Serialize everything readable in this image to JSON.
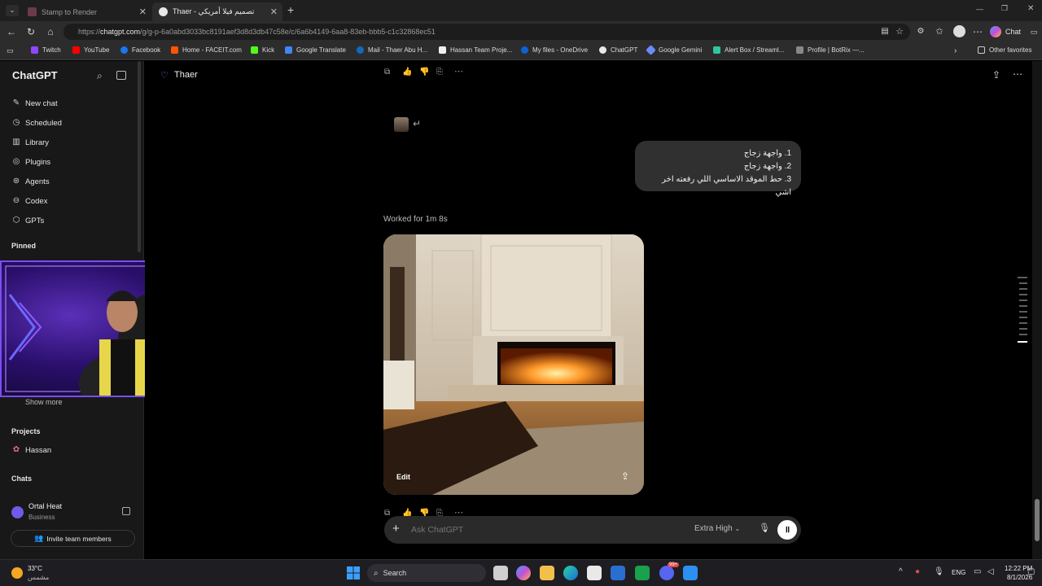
{
  "browser": {
    "tabs": [
      {
        "title": "Stamp to Render",
        "active": false
      },
      {
        "title": "Thaer - تصميم فيلا أمريكي",
        "active": true
      }
    ],
    "url_prefix": "https://",
    "url_host": "chatgpt.com",
    "url_path": "/g/g-p-6a0abd3033bc8191aef3d8d3db47c58e/c/6a6b4149-6aa8-83eb-bbb5-c1c32868ec51",
    "copilot_label": "Chat",
    "bookmarks": [
      "Twitch",
      "YouTube",
      "Facebook",
      "Home - FACEIT.com",
      "Kick",
      "Google Translate",
      "Mail - Thaer Abu H...",
      "Hassan Team Proje...",
      "My files - OneDrive",
      "ChatGPT",
      "Google Gemini",
      "Alert Box / Streaml...",
      "Profile | BotRix —..."
    ],
    "other_favorites": "Other favorites"
  },
  "sidebar": {
    "app_title": "ChatGPT",
    "nav": [
      {
        "label": "New chat",
        "icon": "edit-icon"
      },
      {
        "label": "Scheduled",
        "icon": "clock-icon"
      },
      {
        "label": "Library",
        "icon": "library-icon"
      },
      {
        "label": "Plugins",
        "icon": "plugins-icon"
      },
      {
        "label": "Agents",
        "icon": "agents-icon"
      },
      {
        "label": "Codex",
        "icon": "codex-icon"
      },
      {
        "label": "GPTs",
        "icon": "cube-icon"
      }
    ],
    "pinned_heading": "Pinned",
    "show_more": "Show more",
    "projects_heading": "Projects",
    "project_name": "Hassan",
    "chats_heading": "Chats",
    "workspace_name": "Ortal Heat",
    "workspace_plan": "Business",
    "invite_label": "Invite team members"
  },
  "header": {
    "project_title": "Thaer"
  },
  "chat": {
    "user_message_lines": [
      "1. واجهة زجاج",
      "2. واجهة زجاج",
      "3. حط الموقد الاساسي اللي رفعته اخر اشي"
    ],
    "status": "Worked for 1m 8s",
    "image_edit_label": "Edit"
  },
  "composer": {
    "placeholder": "Ask ChatGPT",
    "model_label": "Extra High"
  },
  "taskbar": {
    "weather_temp": "33°C",
    "weather_desc": "مشمس",
    "search_label": "Search",
    "lang": "ENG",
    "time": "12:22 PM",
    "date": "8/1/2026",
    "badge": "99+"
  },
  "colors": {
    "accent_purple": "#8b5cf6",
    "sidebar_bg": "#181818",
    "bubble_bg": "#303030"
  }
}
